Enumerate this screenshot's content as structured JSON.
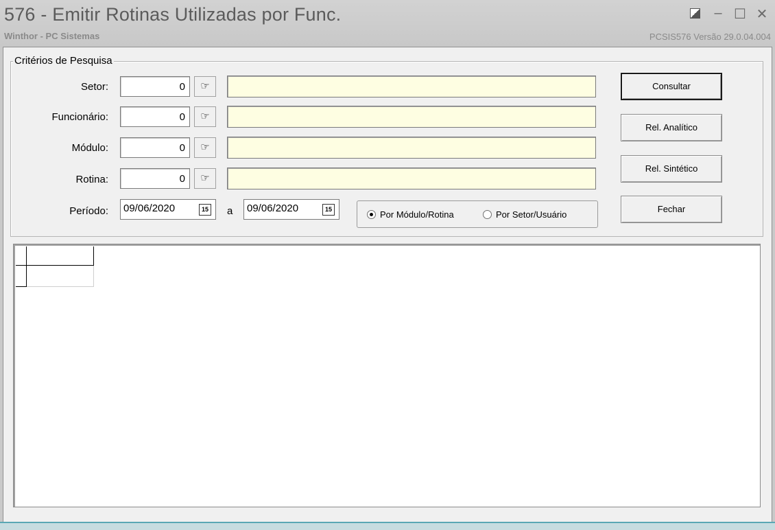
{
  "window": {
    "title": "576 - Emitir Rotinas Utilizadas por Func.",
    "subtitle": "Winthor - PC Sistemas",
    "version": "PCSIS576  Versão  29.0.04.004"
  },
  "criteria": {
    "group_title": "Critérios de Pesquisa",
    "fields": [
      {
        "label": "Setor:",
        "value": "0"
      },
      {
        "label": "Funcionário:",
        "value": "0"
      },
      {
        "label": "Módulo:",
        "value": "0"
      },
      {
        "label": "Rotina:",
        "value": "0"
      }
    ],
    "period": {
      "label": "Período:",
      "start": "09/06/2020",
      "separator": "a",
      "end": "09/06/2020",
      "calendar_icon_text": "15"
    },
    "grouping": {
      "options": [
        "Por Módulo/Rotina",
        "Por Setor/Usuário"
      ],
      "selected": "Por Módulo/Rotina"
    }
  },
  "buttons": {
    "consultar": "Consultar",
    "rel_analitico": "Rel. Analítico",
    "rel_sintetico": "Rel. Sintético",
    "fechar": "Fechar"
  },
  "icons": {
    "lookup": "pointing-hand-icon",
    "calendar": "calendar-icon"
  }
}
